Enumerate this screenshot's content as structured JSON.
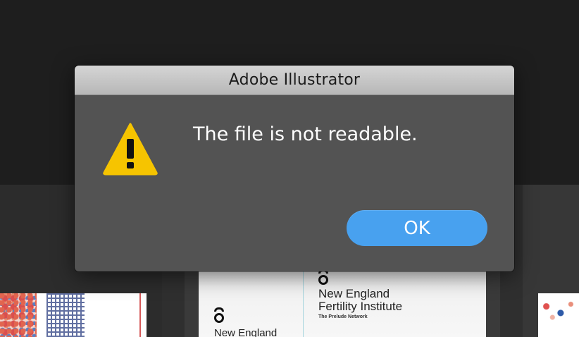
{
  "dialog": {
    "title": "Adobe Illustrator",
    "message": "The file is not readable.",
    "ok_label": "OK",
    "icon": "warning-icon",
    "accent_color": "#48a1ef",
    "warning_color": "#f6c400"
  },
  "background_thumbnails": {
    "center": {
      "brand_line_1": "New England",
      "brand_line_2": "Fertility Institute",
      "brand_tagline": "The Prelude Network",
      "brand_line_1_repeat": "New England"
    }
  }
}
